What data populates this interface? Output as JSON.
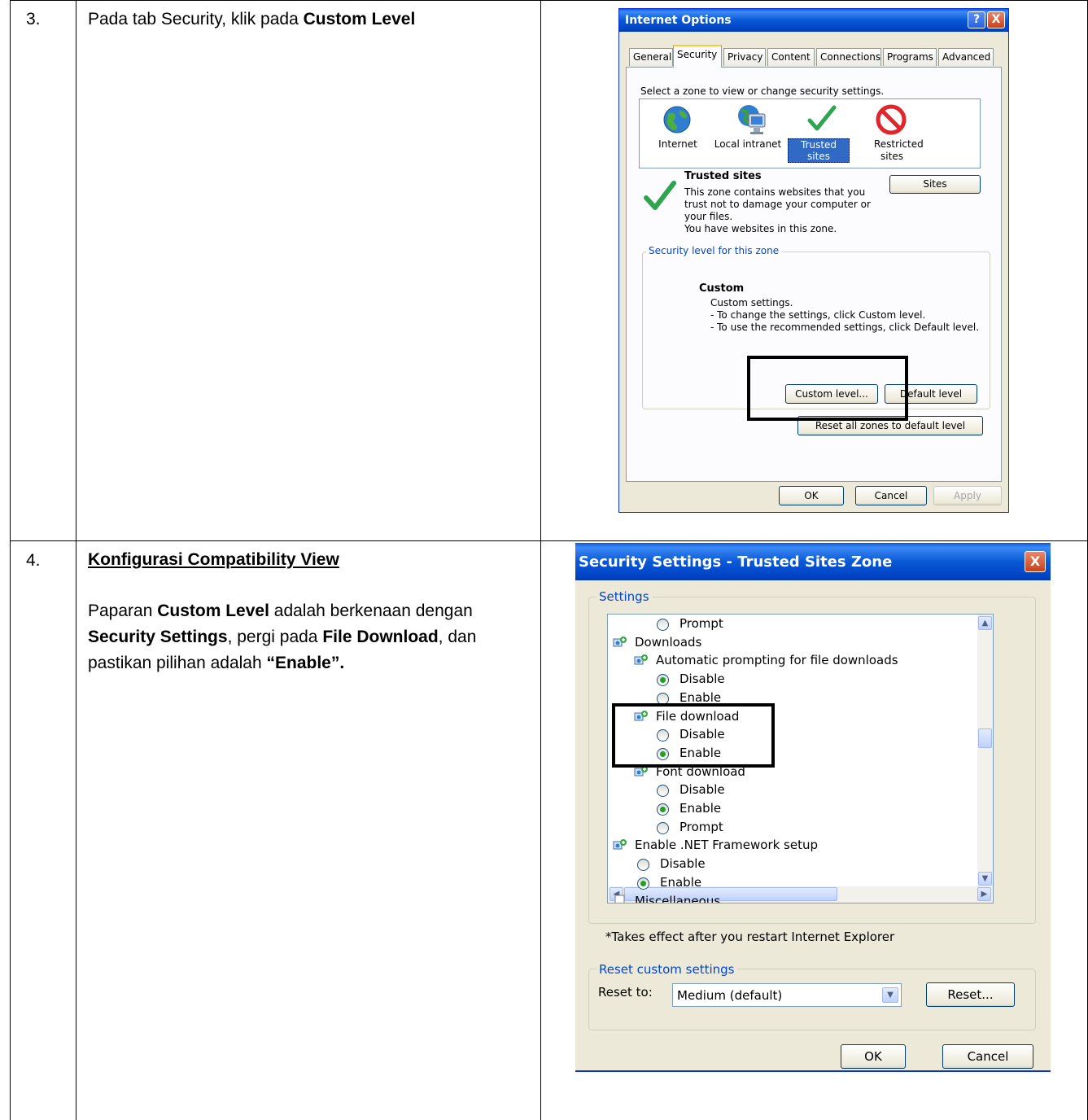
{
  "rows": [
    {
      "number": "3.",
      "instruction_plain": "Pada tab Security, klik pada ",
      "instruction_bold": "Custom Level"
    },
    {
      "number": "4.",
      "heading": "Konfigurasi Compatibility View",
      "para": {
        "t1": "Paparan ",
        "b1": "Custom Level",
        "t2": " adalah berkenaan dengan ",
        "b2": "Security Settings",
        "t3": ", pergi pada ",
        "b3": "File Download",
        "t4": ", dan pastikan pilihan adalah ",
        "b4": "“Enable”."
      }
    }
  ],
  "internet_options": {
    "title": "Internet Options",
    "help_glyph": "?",
    "close_glyph": "X",
    "tabs": [
      "General",
      "Security",
      "Privacy",
      "Content",
      "Connections",
      "Programs",
      "Advanced"
    ],
    "zone_prompt": "Select a zone to view or change security settings.",
    "zones": [
      "Internet",
      "Local intranet",
      "Trusted sites",
      "Restricted sites"
    ],
    "selected_zone_title": "Trusted sites",
    "zone_description_lines": [
      "This zone contains websites that you",
      "trust not to damage your computer or",
      "your files.",
      "You have websites in this zone."
    ],
    "sites_button": "Sites",
    "security_level_group": "Security level for this zone",
    "level_title": "Custom",
    "level_lines": [
      "Custom settings.",
      "- To change the settings, click Custom level.",
      "- To use the recommended settings, click Default level."
    ],
    "custom_level_button": "Custom level...",
    "default_level_button": "Default level",
    "reset_all_button": "Reset all zones to default level",
    "ok_button": "OK",
    "cancel_button": "Cancel",
    "apply_button": "Apply",
    "colors": {
      "title_bar": "#0a58d6",
      "selection": "#316ac5",
      "check_green": "#2fa44f",
      "restricted_red": "#e0262b"
    }
  },
  "security_settings": {
    "title": "Security Settings - Trusted Sites Zone",
    "close_glyph": "X",
    "settings_group": "Settings",
    "tree": [
      {
        "kind": "radio",
        "label": "Prompt",
        "checked": false,
        "level": 2
      },
      {
        "kind": "category",
        "label": "Downloads",
        "level": 0
      },
      {
        "kind": "setting",
        "label": "Automatic prompting for file downloads",
        "level": 1
      },
      {
        "kind": "radio",
        "label": "Disable",
        "checked": true,
        "level": 2
      },
      {
        "kind": "radio",
        "label": "Enable",
        "checked": false,
        "level": 2
      },
      {
        "kind": "setting",
        "label": "File download",
        "level": 1
      },
      {
        "kind": "radio",
        "label": "Disable",
        "checked": false,
        "level": 2
      },
      {
        "kind": "radio",
        "label": "Enable",
        "checked": true,
        "level": 2
      },
      {
        "kind": "setting",
        "label": "Font download",
        "level": 1
      },
      {
        "kind": "radio",
        "label": "Disable",
        "checked": false,
        "level": 2
      },
      {
        "kind": "radio",
        "label": "Enable",
        "checked": true,
        "level": 2
      },
      {
        "kind": "radio",
        "label": "Prompt",
        "checked": false,
        "level": 2
      },
      {
        "kind": "category",
        "label": "Enable .NET Framework setup",
        "level": 0
      },
      {
        "kind": "radio",
        "label": "Disable",
        "checked": false,
        "level": 1
      },
      {
        "kind": "radio",
        "label": "Enable",
        "checked": true,
        "level": 1
      },
      {
        "kind": "category",
        "label": "Miscellaneous",
        "level": 0
      }
    ],
    "restart_note": "*Takes effect after you restart Internet Explorer",
    "reset_group": "Reset custom settings",
    "reset_to_label": "Reset to:",
    "reset_to_value": "Medium (default)",
    "reset_button": "Reset...",
    "ok_button": "OK",
    "cancel_button": "Cancel"
  }
}
